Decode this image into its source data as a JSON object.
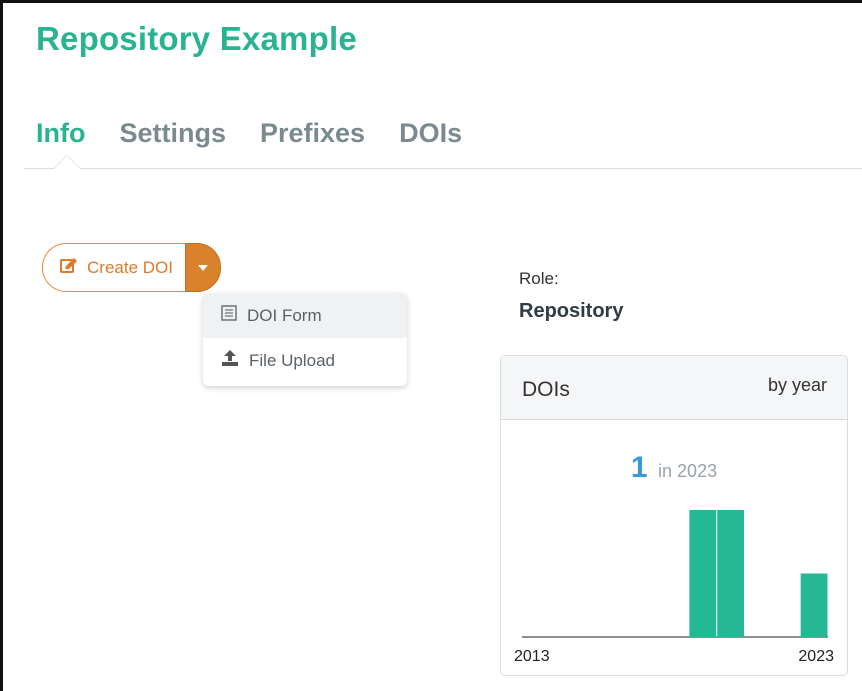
{
  "header": {
    "title": "Repository Example"
  },
  "tabs": [
    {
      "label": "Info",
      "active": true
    },
    {
      "label": "Settings",
      "active": false
    },
    {
      "label": "Prefixes",
      "active": false
    },
    {
      "label": "DOIs",
      "active": false
    }
  ],
  "create_button": {
    "label": "Create DOI",
    "icon": "edit-icon"
  },
  "dropdown": {
    "items": [
      {
        "label": "DOI Form",
        "icon": "form-icon"
      },
      {
        "label": "File Upload",
        "icon": "upload-icon"
      }
    ]
  },
  "role": {
    "label": "Role:",
    "value": "Repository"
  },
  "dois_panel": {
    "title": "DOIs",
    "subtitle": "by year",
    "summary_count": "1",
    "summary_text": "in 2023"
  },
  "chart_data": {
    "type": "bar",
    "x_tick_labels": [
      "2013",
      "2023"
    ],
    "categories": [
      "2013",
      "2014",
      "2015",
      "2016",
      "2017",
      "2018",
      "2019",
      "2020",
      "2021",
      "2022",
      "2023"
    ],
    "values": [
      0,
      0,
      0,
      0,
      0,
      0,
      2,
      2,
      0,
      0,
      1
    ],
    "color": "#26b895"
  },
  "colors": {
    "accent": "#2ab391",
    "button": "#e07a2a",
    "count": "#3a99d8"
  }
}
